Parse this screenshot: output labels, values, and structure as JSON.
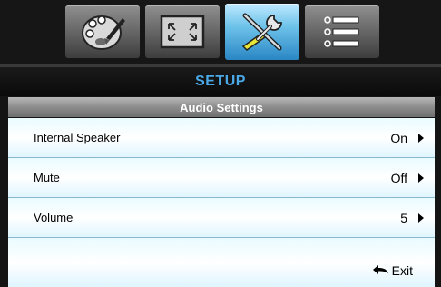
{
  "tabs": [
    {
      "icon": "palette-icon",
      "active": false
    },
    {
      "icon": "screen-icon",
      "active": false
    },
    {
      "icon": "setup-tools-icon",
      "active": true
    },
    {
      "icon": "options-list-icon",
      "active": false
    }
  ],
  "menu": {
    "title": "SETUP",
    "subtitle": "Audio Settings",
    "items": [
      {
        "label": "Internal Speaker",
        "value": "On"
      },
      {
        "label": "Mute",
        "value": "Off"
      },
      {
        "label": "Volume",
        "value": "5"
      }
    ],
    "exit_label": "Exit"
  },
  "colors": {
    "accent": "#4aa9e6",
    "active_tab": "#2a86c4",
    "row_bg": "#e9fbff"
  }
}
